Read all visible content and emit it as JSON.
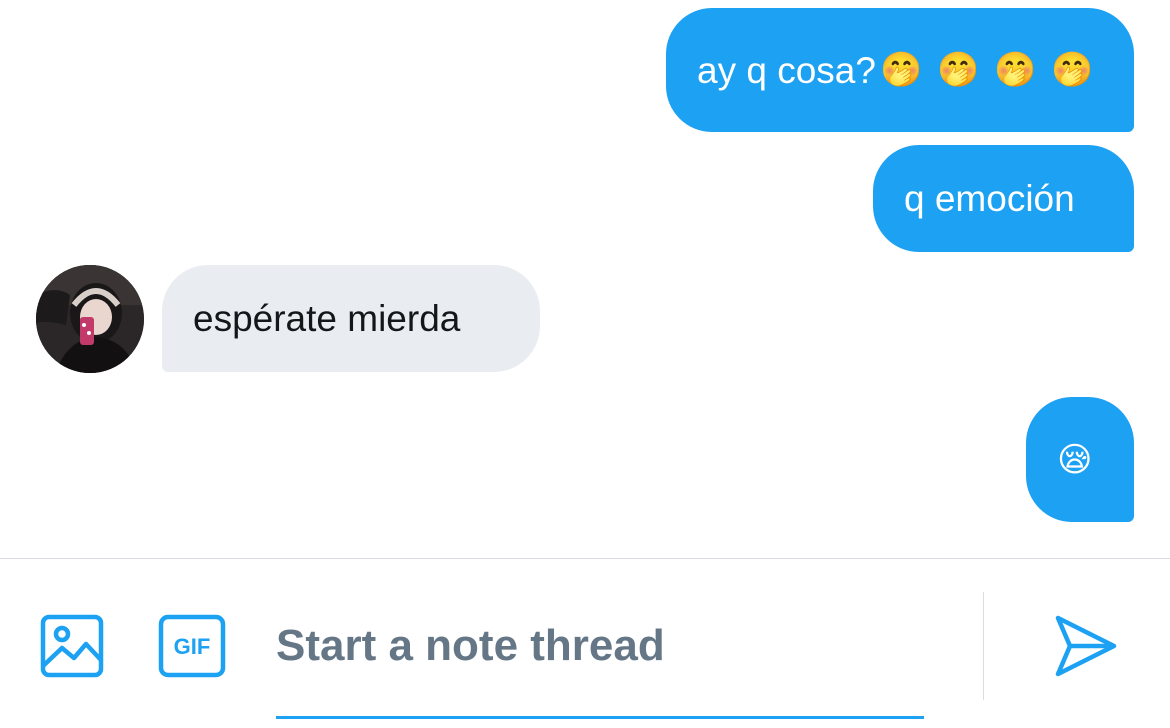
{
  "messages": [
    {
      "direction": "outgoing",
      "text": "ay q cosa?",
      "emoji": "🤭 🤭 🤭 🤭"
    },
    {
      "direction": "outgoing",
      "text": "q emoción"
    },
    {
      "direction": "incoming",
      "text": "espérate mierda",
      "sender_avatar": "avatar"
    },
    {
      "direction": "outgoing",
      "emoji": "😪"
    }
  ],
  "composer": {
    "placeholder": "Start a note thread",
    "value": "",
    "media_icon": "image-icon",
    "gif_icon": "gif-icon",
    "gif_label": "GIF",
    "send_icon": "send-icon"
  },
  "colors": {
    "accent": "#1da1f2",
    "incoming_bubble": "#e9edf1",
    "placeholder": "#657786"
  }
}
